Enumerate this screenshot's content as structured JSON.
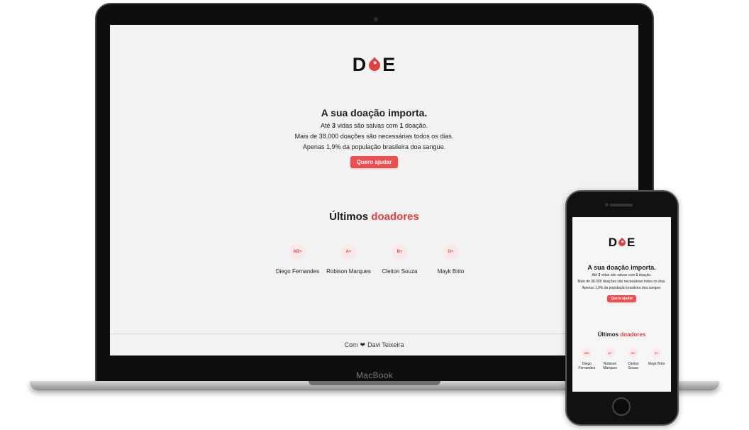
{
  "device": {
    "brand": "MacBook"
  },
  "logo": {
    "left": "D",
    "right": "E"
  },
  "hero": {
    "headline": "A sua doação importa.",
    "line1": {
      "pre": "Até ",
      "bold1": "3",
      "mid": " vidas são salvas com ",
      "bold2": "1",
      "post": " doação."
    },
    "line2": "Mais de 38.000 doações são necessárias todos os dias.",
    "line3": "Apenas 1,9% da população brasileira doa sangue.",
    "button": "Quero ajudar"
  },
  "donors_title": {
    "plain": "Últimos ",
    "accent": "doadores"
  },
  "donors": [
    {
      "blood": "AB+",
      "name": "Diego Fernandes"
    },
    {
      "blood": "A+",
      "name": "Robison Marques"
    },
    {
      "blood": "B+",
      "name": "Cleiton Souza"
    },
    {
      "blood": "O+",
      "name": "Mayk Brito"
    }
  ],
  "footer": {
    "pre": "Com",
    "author": "Davi Teixeira"
  },
  "colors": {
    "accent": "#e83f3f",
    "button": "#f04e4e",
    "blood_bg": "#fbe9ea"
  },
  "icons": [
    "blood-drop-icon",
    "heart-icon",
    "camera-icon",
    "home-button-icon"
  ]
}
